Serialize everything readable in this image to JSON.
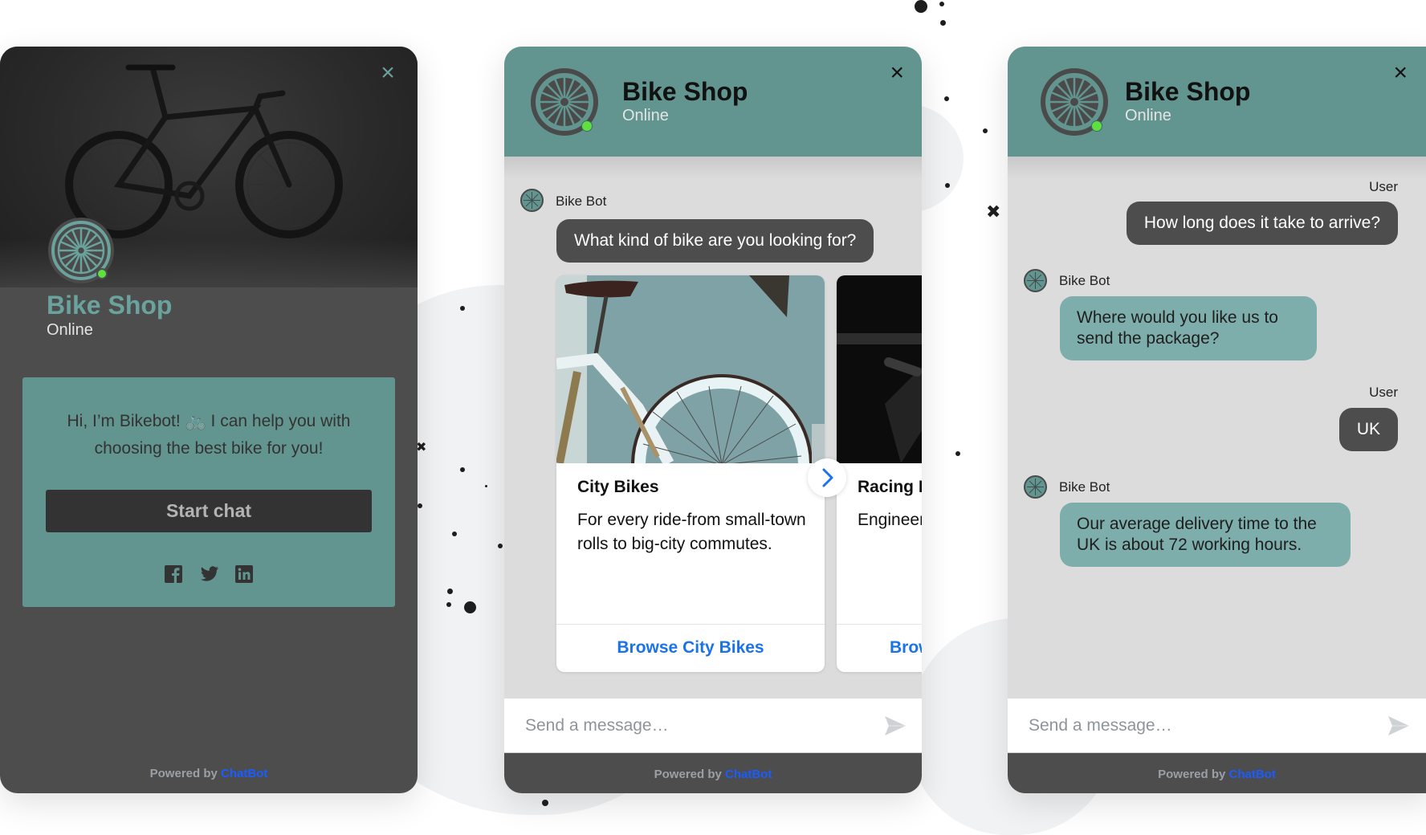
{
  "shop": {
    "name": "Bike Shop",
    "status": "Online",
    "accent_color": "#62958f",
    "online_color": "#5fe041"
  },
  "welcome_panel": {
    "greeting": "Hi, I’m Bikebot! 🚲 I can help you with choosing the best bike for you!",
    "start_chat_label": "Start chat",
    "close_label": "×",
    "social_icons": [
      "facebook-icon",
      "twitter-icon",
      "linkedin-icon"
    ],
    "powered_by_prefix": "Powered by",
    "powered_by_brand": "ChatBot"
  },
  "carousel_panel": {
    "close_label": "×",
    "messages": [
      {
        "sender": "Bike Bot",
        "text": "What kind of bike are you looking for?"
      }
    ],
    "cards": [
      {
        "title": "City Bikes",
        "description": "For every ride-from small-town rolls to big-city commutes.",
        "link_label": "Browse City Bikes"
      },
      {
        "title": "Racing Bikes",
        "description": "Engineered for climbing and descending with comfort and speed.",
        "link_label": "Browse Racing Bikes"
      }
    ],
    "next_icon": "chevron-right-icon",
    "input_placeholder": "Send a message…",
    "powered_by_prefix": "Powered by",
    "powered_by_brand": "ChatBot"
  },
  "conversation_panel": {
    "close_label": "×",
    "messages": [
      {
        "sender": "User",
        "text": "How long does it take to arrive?"
      },
      {
        "sender": "Bike Bot",
        "text": "Where would you like us to send the package?"
      },
      {
        "sender": "User",
        "text": "UK"
      },
      {
        "sender": "Bike Bot",
        "text": "Our average delivery time to the UK is about 72 working hours."
      }
    ],
    "input_placeholder": "Send a message…",
    "powered_by_prefix": "Powered by",
    "powered_by_brand": "ChatBot"
  }
}
